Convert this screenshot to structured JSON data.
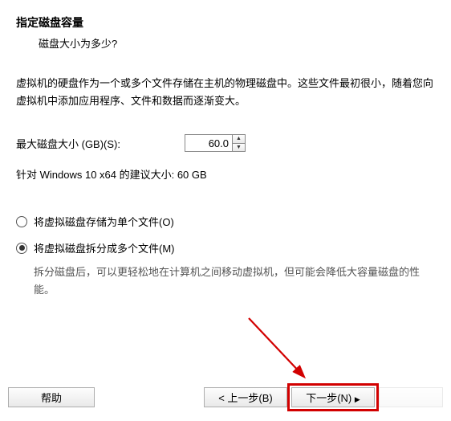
{
  "header": {
    "title": "指定磁盘容量",
    "subtitle": "磁盘大小为多少?"
  },
  "description": "虚拟机的硬盘作为一个或多个文件存储在主机的物理磁盘中。这些文件最初很小，随着您向虚拟机中添加应用程序、文件和数据而逐渐变大。",
  "sizeRow": {
    "label": "最大磁盘大小 (GB)(S):",
    "value": "60.0"
  },
  "recommend": "针对 Windows 10 x64 的建议大小: 60 GB",
  "radios": {
    "single": "将虚拟磁盘存储为单个文件(O)",
    "split": "将虚拟磁盘拆分成多个文件(M)",
    "note": "拆分磁盘后，可以更轻松地在计算机之间移动虚拟机，但可能会降低大容量磁盘的性能。"
  },
  "buttons": {
    "help": "帮助",
    "back": "< 上一步(B)",
    "next": "下一步(N)",
    "cancel": ""
  }
}
